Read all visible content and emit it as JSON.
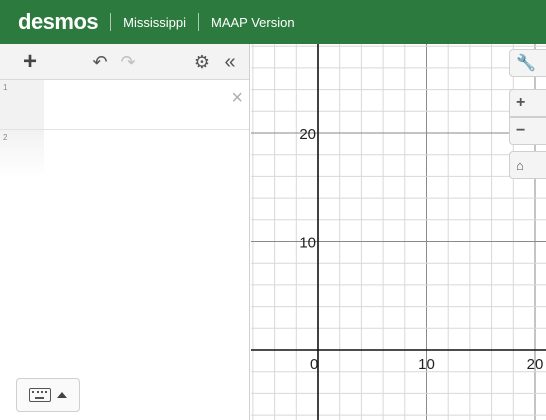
{
  "header": {
    "logo": "desmos",
    "breadcrumb_1": "Mississippi",
    "breadcrumb_2": "MAAP Version",
    "background_color": "#2c7a3e"
  },
  "toolbar": {
    "add": "+",
    "undo": "↶",
    "redo": "↷",
    "settings": "⚙",
    "collapse": "«"
  },
  "expressions": [
    {
      "index": "1",
      "value": "",
      "delete_icon": "×"
    },
    {
      "index": "2",
      "value": ""
    }
  ],
  "keypad_toggle": {
    "icon": "keyboard-icon",
    "arrow": "caret-up-icon"
  },
  "graph_controls": {
    "wrench": "🔧",
    "zoom_in": "+",
    "zoom_out": "−",
    "home": "⌂"
  },
  "graph": {
    "x_ticks": [
      "0",
      "10",
      "20"
    ],
    "y_ticks": [
      "20",
      "10"
    ],
    "grid": true,
    "grid_minor_step": 2,
    "grid_major_step": 10
  }
}
